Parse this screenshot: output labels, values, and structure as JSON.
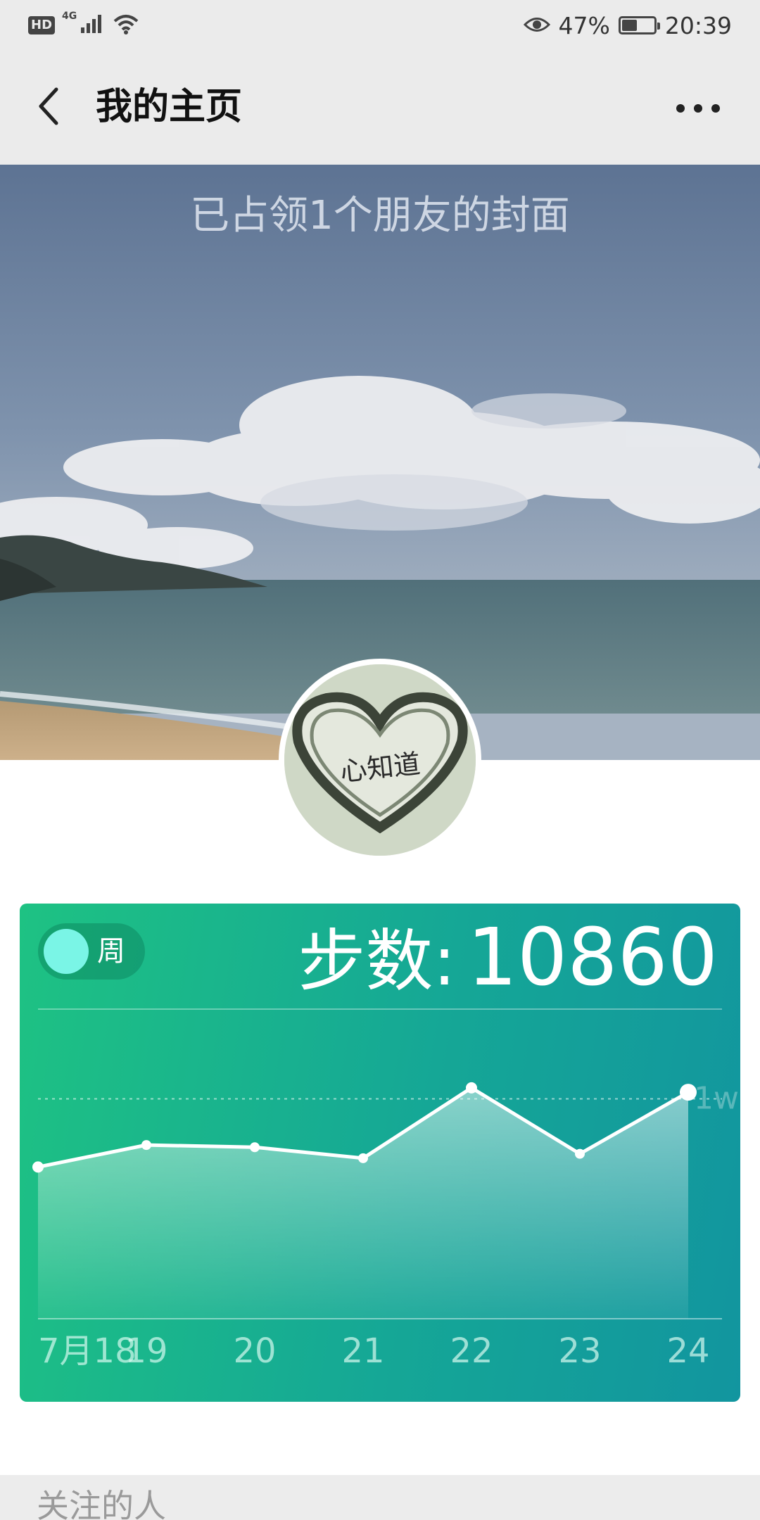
{
  "status_bar": {
    "hd": "HD",
    "network": "4G",
    "battery_percent": "47%",
    "battery_level": 0.47,
    "time": "20:39",
    "icons": [
      "signal-icon",
      "wifi-icon",
      "eye-icon",
      "battery-icon"
    ]
  },
  "header": {
    "title": "我的主页",
    "back_icon": "chevron-left-icon",
    "more_icon": "more-dots-icon"
  },
  "cover": {
    "caption": "已占领1个朋友的封面"
  },
  "avatar": {
    "text": "心知道"
  },
  "step_card": {
    "toggle_label": "周",
    "steps_label": "步数:",
    "steps_value": "10860",
    "reference_label": "1w",
    "colors": {
      "line": "#ffffff",
      "knob": "#7af5e6"
    }
  },
  "chart_data": {
    "type": "area",
    "categories": [
      "7月18",
      "19",
      "20",
      "21",
      "22",
      "23",
      "24"
    ],
    "values": [
      6900,
      7900,
      7800,
      7300,
      10500,
      7500,
      10300
    ],
    "reference_line": 10000,
    "ylim": [
      0,
      16000
    ]
  },
  "following": {
    "label": "关注的人"
  }
}
